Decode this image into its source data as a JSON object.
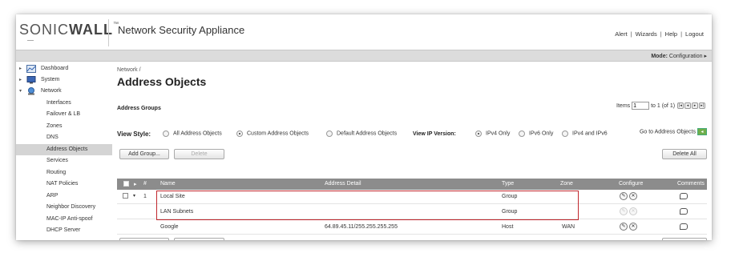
{
  "header": {
    "logo_text_light": "SONIC",
    "logo_text_bold": "WALL",
    "logo_tm": "™",
    "app_title": "Network Security Appliance",
    "links": [
      "Alert",
      "Wizards",
      "Help",
      "Logout"
    ]
  },
  "modebar": {
    "mode_label": "Mode:",
    "mode_value": "Configuration ▸"
  },
  "sidebar": {
    "items": [
      {
        "label": "Dashboard",
        "icon": "dashboard-icon",
        "arrow": "▸"
      },
      {
        "label": "System",
        "icon": "system-icon",
        "arrow": "▸"
      },
      {
        "label": "Network",
        "icon": "network-icon",
        "arrow": "▾"
      },
      {
        "label": "Interfaces"
      },
      {
        "label": "Failover & LB"
      },
      {
        "label": "Zones"
      },
      {
        "label": "DNS"
      },
      {
        "label": "Address Objects",
        "selected": true
      },
      {
        "label": "Services"
      },
      {
        "label": "Routing"
      },
      {
        "label": "NAT Policies"
      },
      {
        "label": "ARP"
      },
      {
        "label": "Neighbor Discovery"
      },
      {
        "label": "MAC-IP Anti-spoof"
      },
      {
        "label": "DHCP Server"
      }
    ]
  },
  "main": {
    "breadcrumb": "Network /",
    "title": "Address Objects",
    "section": "Address Groups",
    "items_label": "Items",
    "items_value": "1",
    "items_range": "to 1 (of 1)",
    "view_style_label": "View Style:",
    "view_style_options": [
      "All Address Objects",
      "Custom Address Objects",
      "Default Address Objects"
    ],
    "view_style_selected": "Custom Address Objects",
    "ip_version_label": "View IP Version:",
    "ip_version_options": [
      "IPv4 Only",
      "IPv6 Only",
      "IPv4 and IPv6"
    ],
    "ip_version_selected": "IPv4 Only",
    "goto_link": "Go to Address Objects",
    "add_group_label": "Add Group...",
    "delete_label": "Delete",
    "delete_all_label": "Delete All"
  },
  "table": {
    "columns": [
      "#",
      "Name",
      "Address Detail",
      "Type",
      "Zone",
      "Configure",
      "Comments"
    ],
    "rows": [
      {
        "num": "1",
        "name": "Local Site",
        "address": "",
        "type": "Group",
        "zone": ""
      },
      {
        "num": "",
        "name": "LAN Subnets",
        "address": "",
        "type": "Group",
        "zone": ""
      },
      {
        "num": "",
        "name": "Google",
        "address": "64.89.45.11/255.255.255.255",
        "type": "Host",
        "zone": "WAN"
      }
    ]
  },
  "colors": {
    "highlight": "#c1272d",
    "table_header": "#8c8c8c",
    "selected_nav": "#d4d4d4"
  }
}
